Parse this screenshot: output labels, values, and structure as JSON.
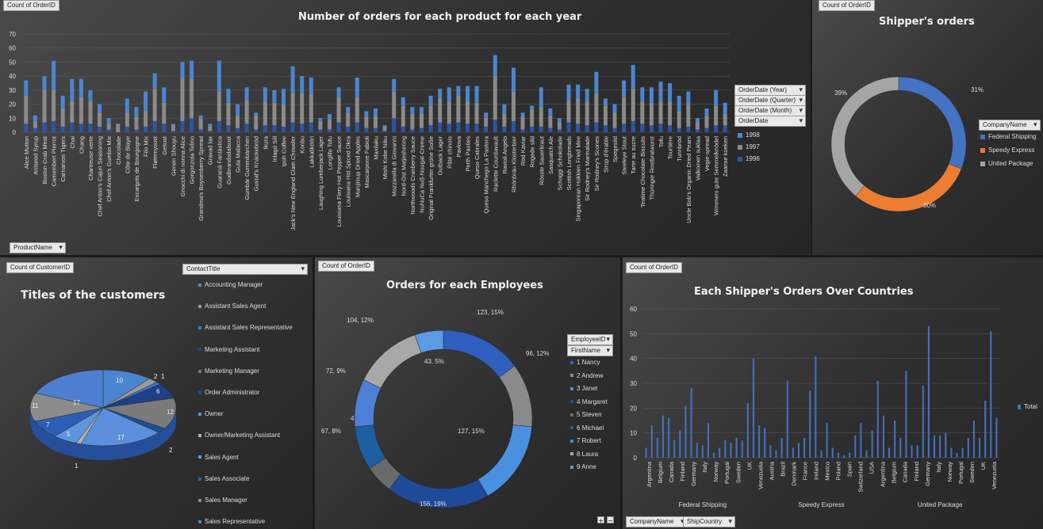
{
  "p1": {
    "count_label": "Count of OrderID",
    "title": "Number of orders for each product for each year",
    "row_field": "ProductName",
    "filters": [
      "OrderDate (Year)",
      "OrderDate (Quarter)",
      "OrderDate (Month)",
      "OrderDate"
    ],
    "legend": [
      {
        "label": "1998",
        "color": "#4a86d0"
      },
      {
        "label": "1997",
        "color": "#8a8a8a"
      },
      {
        "label": "1996",
        "color": "#2a55a8"
      }
    ]
  },
  "p2": {
    "count_label": "Count of OrderID",
    "title": "Shipper's orders",
    "filter": "CompanyName",
    "legend": [
      {
        "label": "Federal Shipping",
        "color": "#4472c4"
      },
      {
        "label": "Speedy Express",
        "color": "#ed7d31"
      },
      {
        "label": "United Package",
        "color": "#a5a5a5"
      }
    ]
  },
  "p3": {
    "count_label": "Count of CustomerID",
    "title": "Titles of the customers",
    "filter": "ContactTitle",
    "legend": [
      {
        "label": "Accounting Manager",
        "color": "#4a86d0"
      },
      {
        "label": "Assistant Sales Agent",
        "color": "#9a9a9a"
      },
      {
        "label": "Assistant Sales Representative",
        "color": "#3a78c8"
      },
      {
        "label": "Marketing Assistant",
        "color": "#1f3f8a"
      },
      {
        "label": "Marketing Manager",
        "color": "#7a7a7a"
      },
      {
        "label": "Order Administrator",
        "color": "#1d4f96"
      },
      {
        "label": "Owner",
        "color": "#5b8fdc"
      },
      {
        "label": "Owner/Marketing Assistant",
        "color": "#b0b0b0"
      },
      {
        "label": "Sales Agent",
        "color": "#5e96dd"
      },
      {
        "label": "Sales Associate",
        "color": "#2b5fb5"
      },
      {
        "label": "Sales Manager",
        "color": "#8c8c8c"
      },
      {
        "label": "Sales Representative",
        "color": "#4e7fd0"
      }
    ]
  },
  "p4": {
    "count_label": "Count of OrderID",
    "title": "Orders for each Employees",
    "filters": [
      "EmployeeID",
      "FirstName"
    ],
    "legend": [
      {
        "label": "1 Nancy",
        "color": "#2f5fc0"
      },
      {
        "label": "2 Andrew",
        "color": "#8a8a8a"
      },
      {
        "label": "3 Janet",
        "color": "#4a90e0"
      },
      {
        "label": "4 Margaret",
        "color": "#1f4a9a"
      },
      {
        "label": "5 Steven",
        "color": "#6a6a6a"
      },
      {
        "label": "6 Michael",
        "color": "#1d5fa0"
      },
      {
        "label": "7 Robert",
        "color": "#4f80d8"
      },
      {
        "label": "8 Laura",
        "color": "#a8a8a8"
      },
      {
        "label": "9 Anne",
        "color": "#5a9ae6"
      }
    ]
  },
  "p5": {
    "count_label": "Count of OrderID",
    "title": "Each Shipper's Orders Over Countries",
    "filters": [
      "CompanyName",
      "ShipCountry"
    ],
    "legend_label": "Total",
    "legend_color": "#4472c4"
  },
  "chart_data": [
    {
      "type": "bar",
      "stacked": true,
      "title": "Number of orders for each product for each year",
      "categories": [
        "Alice Mutton",
        "Aniseed Syrup",
        "Boston Crab Meat",
        "Camembert Pierrot",
        "Carnarvon Tigers",
        "Chai",
        "Chang",
        "Chartreuse verte",
        "Chef Anton's Cajun Seasoning",
        "Chef Anton's Gumbo Mix",
        "Chocolade",
        "Côte de Blaye",
        "Escargots de Bourgogne",
        "Filo Mix",
        "Fløtemysost",
        "Geitost",
        "Genen Shouyu",
        "Gnocchi di nonna Alice",
        "Gorgonzola Telino",
        "Grandma's Boysenberry Spread",
        "Gravad lax",
        "Guaraná Fantástica",
        "Gudbrandsdalsost",
        "Gula Malacca",
        "Gumbär Gummibärchen",
        "Gustaf's Knäckebröd",
        "Ikura",
        "Inlagd Sill",
        "Ipoh Coffee",
        "Jack's New England Clam Chowder",
        "Konbu",
        "Lakkalikööri",
        "Laughing Lumberjack Lager",
        "Longlife Tofu",
        "Louisiana Fiery Hot Pepper Sauce",
        "Louisiana Hot Spiced Okra",
        "Manjimup Dried Apples",
        "Mascarpone Fabioli",
        "Maxilaku",
        "Mishi Kobe Niku",
        "Mozzarella di Giovanni",
        "Nord-Ost Matjeshering",
        "Northwoods Cranberry Sauce",
        "NuNuCa Nuß-Nougat-Creme",
        "Original Frankfurter grüne Soße",
        "Outback Lager",
        "Pâté chinois",
        "Pavlova",
        "Perth Pasties",
        "Queso Cabrales",
        "Queso Manchego La Pastora",
        "Raclette Courdavault",
        "Ravioli Angelo",
        "Rhönbräu Klosterbier",
        "Röd Kaviar",
        "Rogede sild",
        "Rössle Sauerkraut",
        "Sasquatch Ale",
        "Schoggi Schokolade",
        "Scottish Longbreads",
        "Singaporean Hokkien Fried Mee",
        "Sir Rodney's Marmalade",
        "Sir Rodney's Scones",
        "Sirop d'érable",
        "Spegesild",
        "Steeleye Stout",
        "Tarte au sucre",
        "Teatime Chocolate Biscuits",
        "Thüringer Rostbratwurst",
        "Tofu",
        "Tourtière",
        "Tunnbröd",
        "Uncle Bob's Organic Dried Pears",
        "Valkoinen suklaa",
        "Vegie-spread",
        "Wimmers gute Semmelknödel",
        "Zaanse koeken"
      ],
      "series": [
        {
          "name": "1996",
          "values": [
            6,
            3,
            7,
            8,
            4,
            7,
            6,
            6,
            4,
            2,
            0,
            4,
            2,
            4,
            8,
            6,
            1,
            8,
            10,
            2,
            1,
            8,
            5,
            3,
            6,
            2,
            5,
            5,
            4,
            7,
            6,
            7,
            2,
            2,
            7,
            4,
            7,
            3,
            3,
            1,
            10,
            4,
            2,
            3,
            5,
            7,
            6,
            7,
            6,
            6,
            4,
            9,
            4,
            8,
            2,
            4,
            4,
            3,
            2,
            7,
            6,
            5,
            7,
            5,
            3,
            6,
            8,
            6,
            5,
            6,
            5,
            3,
            4,
            2,
            3,
            5,
            5
          ]
        },
        {
          "name": "1997",
          "values": [
            20,
            5,
            23,
            22,
            13,
            15,
            19,
            16,
            10,
            4,
            6,
            10,
            9,
            11,
            23,
            15,
            4,
            31,
            28,
            8,
            3,
            21,
            16,
            9,
            17,
            10,
            17,
            16,
            16,
            21,
            22,
            20,
            6,
            7,
            18,
            10,
            18,
            8,
            9,
            3,
            19,
            15,
            11,
            10,
            14,
            17,
            16,
            19,
            16,
            15,
            6,
            31,
            9,
            21,
            9,
            12,
            14,
            9,
            5,
            16,
            18,
            17,
            21,
            14,
            11,
            19,
            23,
            16,
            16,
            16,
            17,
            12,
            16,
            5,
            9,
            14,
            8
          ]
        },
        {
          "name": "1998",
          "values": [
            11,
            4,
            10,
            21,
            9,
            16,
            13,
            8,
            6,
            4,
            0,
            10,
            7,
            14,
            11,
            11,
            1,
            11,
            13,
            2,
            2,
            22,
            10,
            8,
            9,
            2,
            10,
            9,
            11,
            19,
            12,
            12,
            2,
            4,
            7,
            4,
            14,
            4,
            5,
            1,
            9,
            6,
            5,
            5,
            7,
            7,
            10,
            7,
            11,
            12,
            4,
            15,
            7,
            17,
            3,
            3,
            14,
            5,
            3,
            11,
            10,
            9,
            15,
            5,
            6,
            12,
            17,
            10,
            11,
            14,
            13,
            11,
            9,
            3,
            5,
            11,
            8
          ]
        }
      ],
      "ylim": [
        0,
        70
      ],
      "xlabel": "",
      "ylabel": ""
    },
    {
      "type": "pie",
      "title": "Shipper's orders",
      "categories": [
        "Federal Shipping",
        "Speedy Express",
        "United Package"
      ],
      "values": [
        31,
        30,
        39
      ],
      "data_labels": [
        "31%",
        "30%",
        "39%"
      ]
    },
    {
      "type": "pie",
      "title": "Titles of the customers",
      "categories": [
        "Accounting Manager",
        "Assistant Sales Agent",
        "Assistant Sales Representative",
        "Marketing Assistant",
        "Marketing Manager",
        "Order Administrator",
        "Owner",
        "Owner/Marketing Assistant",
        "Sales Agent",
        "Sales Associate",
        "Sales Manager",
        "Sales Representative"
      ],
      "values": [
        10,
        2,
        1,
        6,
        12,
        2,
        17,
        1,
        5,
        7,
        11,
        17
      ],
      "data_labels": [
        "10",
        "2",
        "1",
        "6",
        "12",
        "2",
        "17",
        "1",
        "5",
        "7",
        "11",
        "17"
      ]
    },
    {
      "type": "pie",
      "title": "Orders for each Employees",
      "categories": [
        "1 Nancy",
        "2 Andrew",
        "3 Janet",
        "4 Margaret",
        "5 Steven",
        "6 Michael",
        "7 Robert",
        "8 Laura",
        "9 Anne"
      ],
      "values": [
        123,
        96,
        127,
        156,
        42,
        67,
        72,
        104,
        43
      ],
      "data_labels": [
        "123, 15%",
        "96, 12%",
        "127, 15%",
        "156, 19%",
        "42, 5%",
        "67, 8%",
        "72, 9%",
        "104, 12%",
        "43, 5%"
      ]
    },
    {
      "type": "bar",
      "title": "Each Shipper's Orders Over Countries",
      "groups": [
        "Federal Shipping",
        "Speedy Express",
        "United Package"
      ],
      "group_sizes": [
        21,
        21,
        21
      ],
      "x_tick_labels": [
        "Argentina",
        "Belgium",
        "Canada",
        "Finland",
        "Germany",
        "Italy",
        "Norway",
        "Portugal",
        "Sweden",
        "UK",
        "Venezuela",
        "Austria",
        "Brazil",
        "Denmark",
        "France",
        "Ireland",
        "Mexico",
        "Poland",
        "Spain",
        "Switzerland",
        "USA",
        "Argentina",
        "Belgium",
        "Canada",
        "Finland",
        "Germany",
        "Italy",
        "Norway",
        "Portugal",
        "Sweden",
        "UK",
        "Venezuela"
      ],
      "series": [
        {
          "name": "Total",
          "values": [
            4,
            13,
            8,
            17,
            16,
            7,
            11,
            21,
            28,
            6,
            5,
            14,
            2,
            4,
            7,
            6,
            8,
            7,
            22,
            40,
            13,
            12,
            5,
            3,
            8,
            31,
            4,
            6,
            8,
            27,
            41,
            3,
            14,
            4,
            2,
            1,
            2,
            9,
            14,
            3,
            11,
            31,
            17,
            4,
            15,
            8,
            35,
            5,
            5,
            29,
            53,
            9,
            9,
            10,
            4,
            2,
            4,
            8,
            15,
            8,
            23,
            51,
            16
          ]
        }
      ],
      "ylim": [
        0,
        60
      ],
      "xlabel": "",
      "ylabel": ""
    }
  ]
}
